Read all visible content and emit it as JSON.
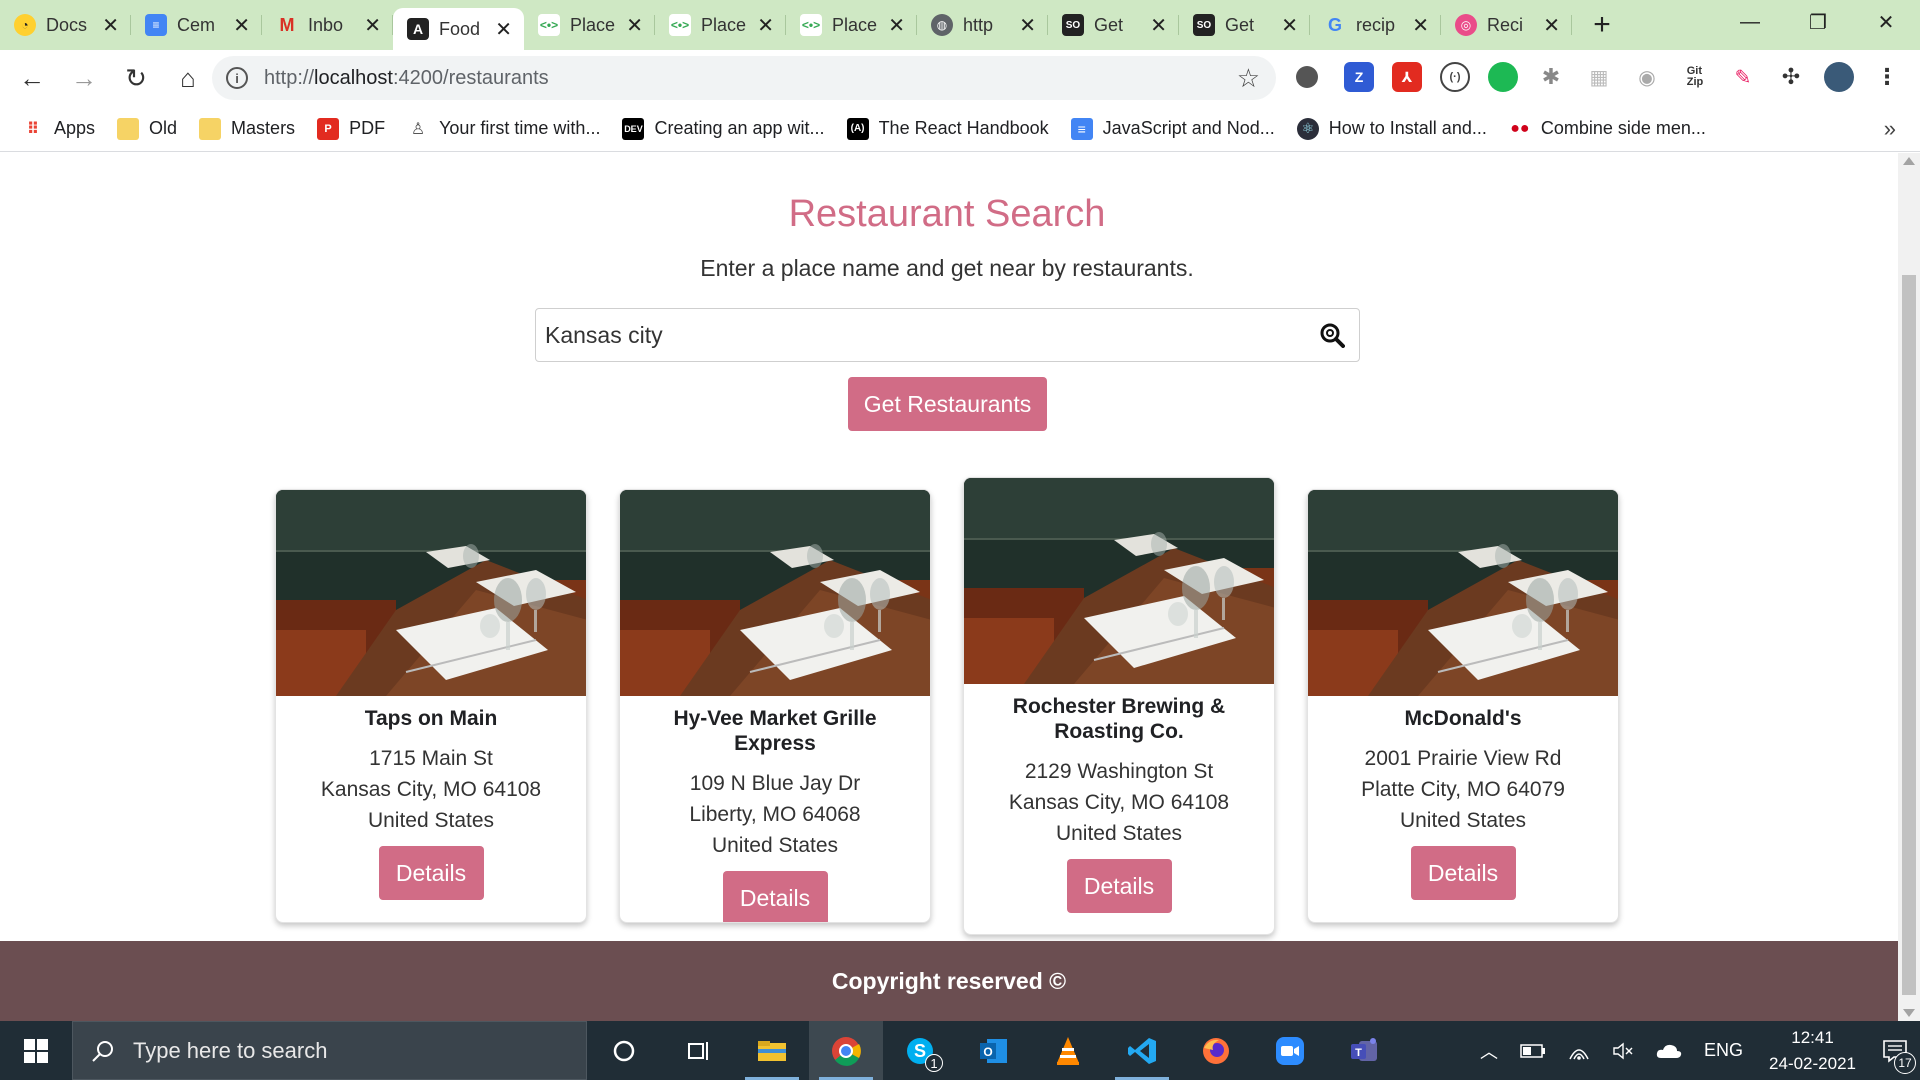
{
  "browser": {
    "tabs": [
      {
        "title": "Docs",
        "icon": "miro-icon",
        "active": false
      },
      {
        "title": "Cem",
        "icon": "docs-icon",
        "active": false
      },
      {
        "title": "Inbo",
        "icon": "gmail-icon",
        "active": false
      },
      {
        "title": "Food",
        "icon": "angular-icon",
        "active": true
      },
      {
        "title": "Place",
        "icon": "places-icon",
        "active": false
      },
      {
        "title": "Place",
        "icon": "places-icon",
        "active": false
      },
      {
        "title": "Place",
        "icon": "places-icon",
        "active": false
      },
      {
        "title": "http",
        "icon": "globe-icon",
        "active": false
      },
      {
        "title": "Get",
        "icon": "stackoverflow-icon",
        "active": false
      },
      {
        "title": "Get",
        "icon": "stackoverflow-icon",
        "active": false
      },
      {
        "title": "recip",
        "icon": "google-icon",
        "active": false
      },
      {
        "title": "Reci",
        "icon": "dribbble-icon",
        "active": false
      }
    ],
    "new_tab": "+",
    "url_prefix": "http://",
    "url_host": "localhost",
    "url_rest": ":4200/restaurants",
    "bookmarks": [
      {
        "label": "Apps",
        "icon": "apps-grid-icon"
      },
      {
        "label": "Old",
        "icon": "folder-icon"
      },
      {
        "label": "Masters",
        "icon": "folder-icon"
      },
      {
        "label": "PDF",
        "icon": "pdf-icon"
      },
      {
        "label": "Your first time with...",
        "icon": "firebase-icon"
      },
      {
        "label": "Creating an app wit...",
        "icon": "dev-icon"
      },
      {
        "label": "The React Handbook",
        "icon": "flavio-icon"
      },
      {
        "label": "JavaScript and Nod...",
        "icon": "docs-icon"
      },
      {
        "label": "How to Install and...",
        "icon": "electron-icon"
      },
      {
        "label": "Combine side men...",
        "icon": "dots-icon"
      }
    ],
    "bookmarks_more": "»"
  },
  "page": {
    "title": "Restaurant Search",
    "subtitle": "Enter a place name and get near by restaurants.",
    "search_value": "Kansas city",
    "get_button": "Get Restaurants",
    "restaurants": [
      {
        "name": "Taps on Main",
        "address1": "1715 Main St",
        "address2": "Kansas City, MO 64108",
        "country": "United States",
        "button": "Details"
      },
      {
        "name": "Hy-Vee Market Grille Express",
        "address1": "109 N Blue Jay Dr",
        "address2": "Liberty, MO 64068",
        "country": "United States",
        "button": "Details"
      },
      {
        "name": "Rochester Brewing & Roasting Co.",
        "address1": "2129 Washington St",
        "address2": "Kansas City, MO 64108",
        "country": "United States",
        "button": "Details"
      },
      {
        "name": "McDonald's",
        "address1": "2001 Prairie View Rd",
        "address2": "Platte City, MO 64079",
        "country": "United States",
        "button": "Details"
      }
    ],
    "footer": "Copyright reserved ©",
    "accent_color": "#d16c86",
    "footer_color": "#6b4e51"
  },
  "taskbar": {
    "search_placeholder": "Type here to search",
    "language": "ENG",
    "time": "12:41",
    "date": "24-02-2021",
    "notification_count": "17",
    "skype_badge": "1"
  }
}
